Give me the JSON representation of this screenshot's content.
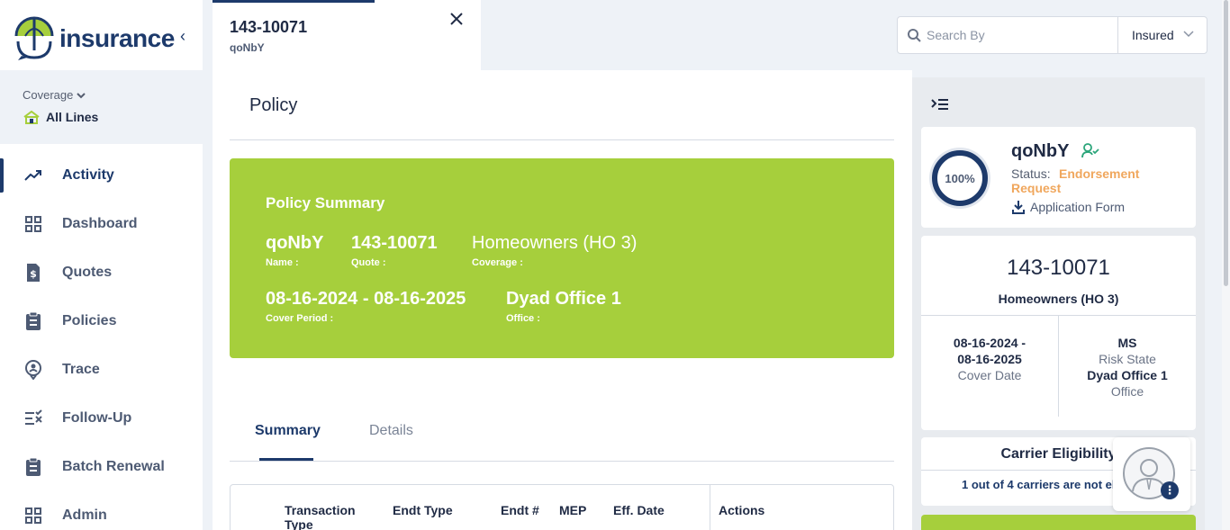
{
  "brand": {
    "name": "insurance",
    "accent": "#1d3a6b",
    "green": "#a6cf3c"
  },
  "coverage": {
    "label": "Coverage",
    "value": "All Lines"
  },
  "nav": [
    {
      "label": "Activity",
      "icon": "trending-up-icon",
      "active": true
    },
    {
      "label": "Dashboard",
      "icon": "grid-icon"
    },
    {
      "label": "Quotes",
      "icon": "dollar-document-icon"
    },
    {
      "label": "Policies",
      "icon": "clipboard-icon"
    },
    {
      "label": "Trace",
      "icon": "map-pin-icon"
    },
    {
      "label": "Follow-Up",
      "icon": "checklist-icon"
    },
    {
      "label": "Batch Renewal",
      "icon": "clipboard-icon"
    },
    {
      "label": "Admin",
      "icon": "grid-icon"
    }
  ],
  "open_tab": {
    "title": "143-10071",
    "subtitle": "qoNbY"
  },
  "search": {
    "placeholder": "Search By",
    "filter": "Insured"
  },
  "page": {
    "title": "Policy"
  },
  "summary": {
    "title": "Policy Summary",
    "name_value": "qoNbY",
    "name_label": "Name :",
    "quote_value": "143-10071",
    "quote_label": "Quote :",
    "coverage_value": "Homeowners (HO 3)",
    "coverage_label": "Coverage :",
    "period_value": "08-16-2024 - 08-16-2025",
    "period_label": "Cover Period :",
    "office_value": "Dyad Office 1",
    "office_label": "Office :"
  },
  "tabs": {
    "summary": "Summary",
    "details": "Details"
  },
  "table": {
    "headers": [
      "Transaction Type",
      "Endt Type",
      "Endt #",
      "MEP",
      "Eff. Date",
      "Actions"
    ]
  },
  "right_panel": {
    "progress_text": "100%",
    "insured_name": "qoNbY",
    "status_label": "Status:",
    "status_value": "Endorsement Request",
    "app_form": "Application Form",
    "policy_number": "143-10071",
    "coverage": "Homeowners (HO 3)",
    "cover_date_value_1": "08-16-2024 -",
    "cover_date_value_2": "08-16-2025",
    "cover_date_label": "Cover Date",
    "risk_state_value": "MS",
    "risk_state_label": "Risk State",
    "office_value": "Dyad Office 1",
    "office_label": "Office",
    "carrier_title": "Carrier Eligibility",
    "carrier_text": "1 out of 4 carriers are not eligible"
  }
}
